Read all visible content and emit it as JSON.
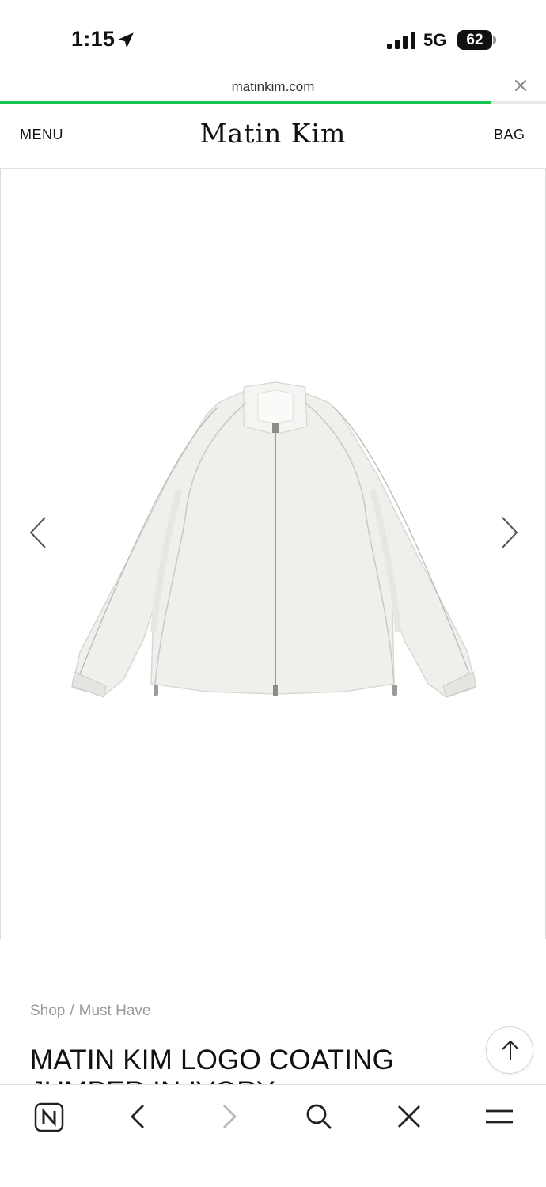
{
  "status_bar": {
    "time": "1:15",
    "network": "5G",
    "battery": "62"
  },
  "browser": {
    "url": "matinkim.com",
    "load_progress": 0.9
  },
  "header": {
    "menu_label": "MENU",
    "logo_text": "Matin Kim",
    "bag_label": "BAG"
  },
  "product": {
    "breadcrumb": [
      "Shop",
      "Must Have"
    ],
    "title": "MATIN KIM LOGO COATING JUMPER IN IVORY",
    "image": "ivory zip-up jumper"
  },
  "icons": {
    "location": "location-arrow-icon",
    "signal": "cellular-signal-icon",
    "close": "close-icon",
    "prev": "chevron-left-icon",
    "next": "chevron-right-icon",
    "scroll_top": "arrow-up-icon",
    "naver": "naver-n-icon",
    "back": "back-icon",
    "forward": "forward-icon",
    "search": "search-icon",
    "close_tab": "close-icon",
    "menu": "hamburger-icon"
  },
  "colors": {
    "accent": "#18c452",
    "text": "#111111",
    "muted": "#9a9a9a"
  }
}
